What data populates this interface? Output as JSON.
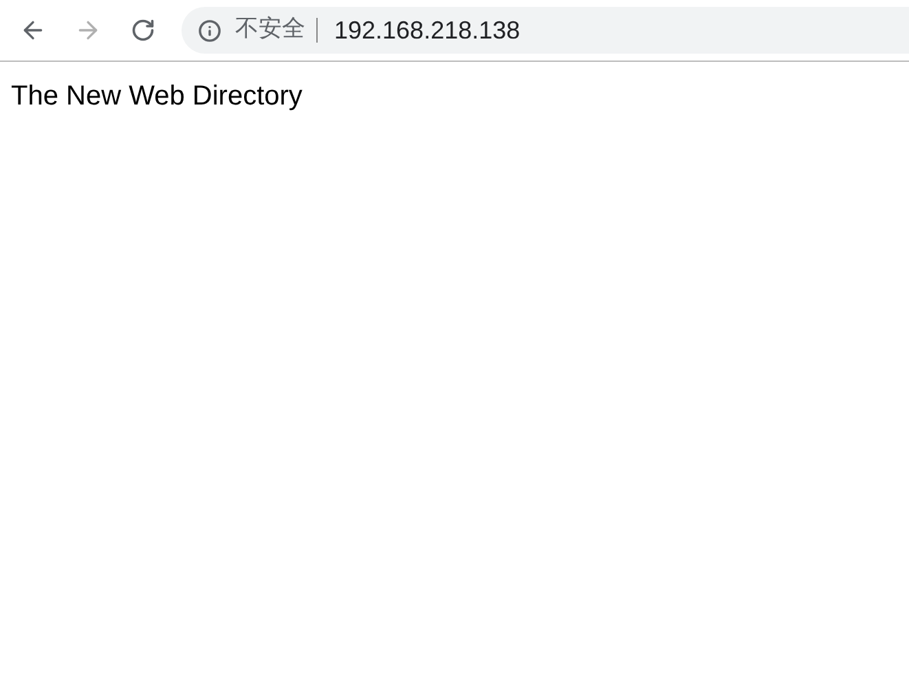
{
  "toolbar": {
    "back": {
      "disabled": false
    },
    "forward": {
      "disabled": true
    },
    "address_bar": {
      "security_label": "不安全",
      "url": "192.168.218.138"
    }
  },
  "page": {
    "heading": "The New Web Directory"
  }
}
